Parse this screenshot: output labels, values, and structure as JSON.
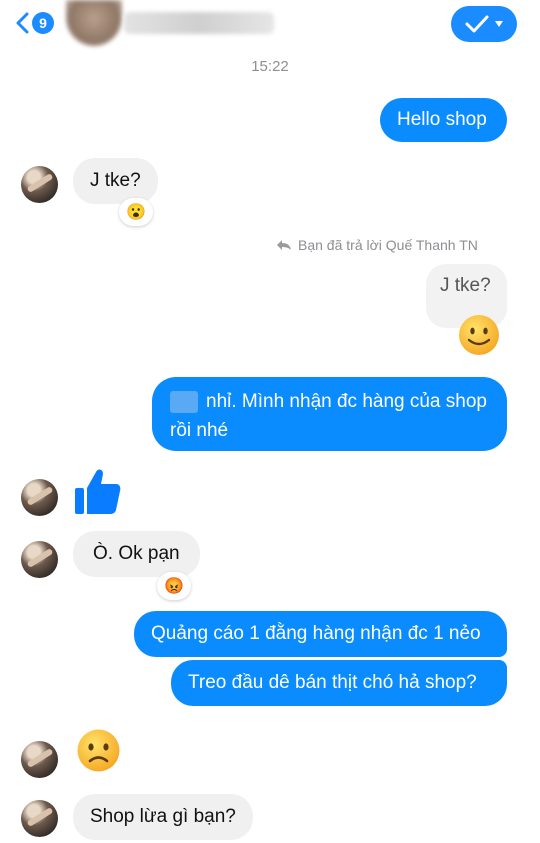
{
  "header": {
    "unread_count": "9"
  },
  "timestamp": "15:22",
  "messages": {
    "m1": "Hello shop",
    "m2": "J tke?",
    "m2_reaction": "😮",
    "reply_note": "Bạn đã trả lời Quế Thanh TN",
    "quoted": "J tke?",
    "m3_line1": "nhỉ. Mình nhận đc hàng của shop",
    "m3_line2": "rồi nhé",
    "m4": "Ò. Ok pạn",
    "m4_reaction": "😡",
    "m5": "Quảng cáo 1 đằng hàng nhận đc 1 nẻo",
    "m6": "Treo đầu dê bán thịt chó hả shop?",
    "m7": "Shop lừa gì bạn?"
  },
  "colors": {
    "accent": "#0a8cff",
    "incoming_bubble": "#f0f0f0"
  }
}
